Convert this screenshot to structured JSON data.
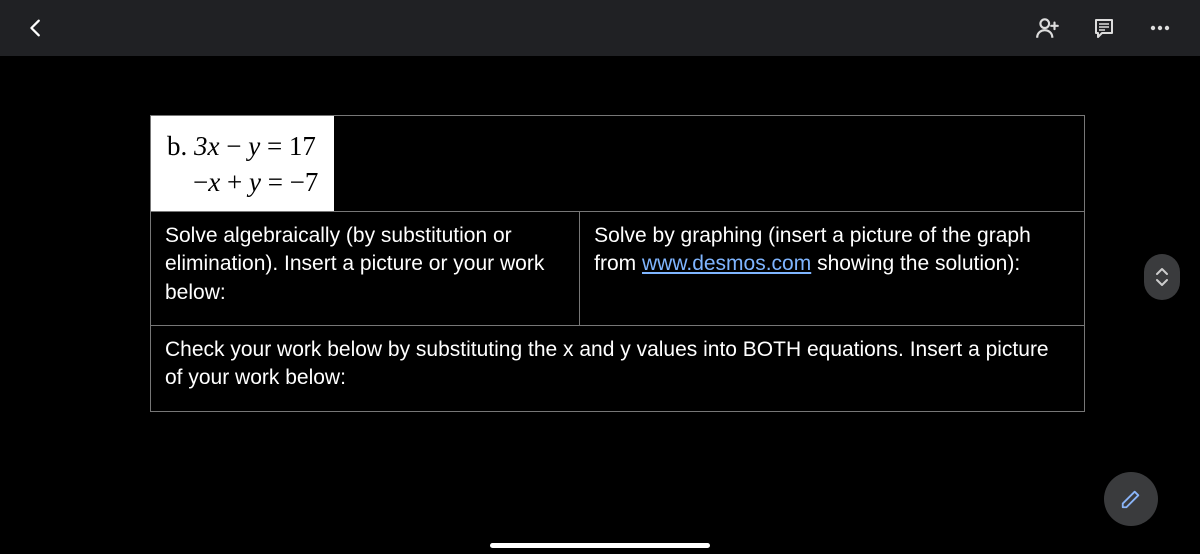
{
  "problem": {
    "label": "b.",
    "equation1_lhs": "3x − y",
    "equation1_rhs": "= 17",
    "equation2_lhs": "−x + y",
    "equation2_rhs": "= −7"
  },
  "instructions": {
    "algebraic": "Solve algebraically (by substitution or elimination). Insert a picture or your work below:",
    "graphing_pre": "Solve by graphing (insert a picture of the graph from ",
    "graphing_link_text": "www.desmos.com",
    "graphing_link_href": "http://www.desmos.com",
    "graphing_post": " showing the solution):",
    "check": "Check your work below by substituting the x and y values into BOTH equations. Insert a picture of your work below:"
  }
}
